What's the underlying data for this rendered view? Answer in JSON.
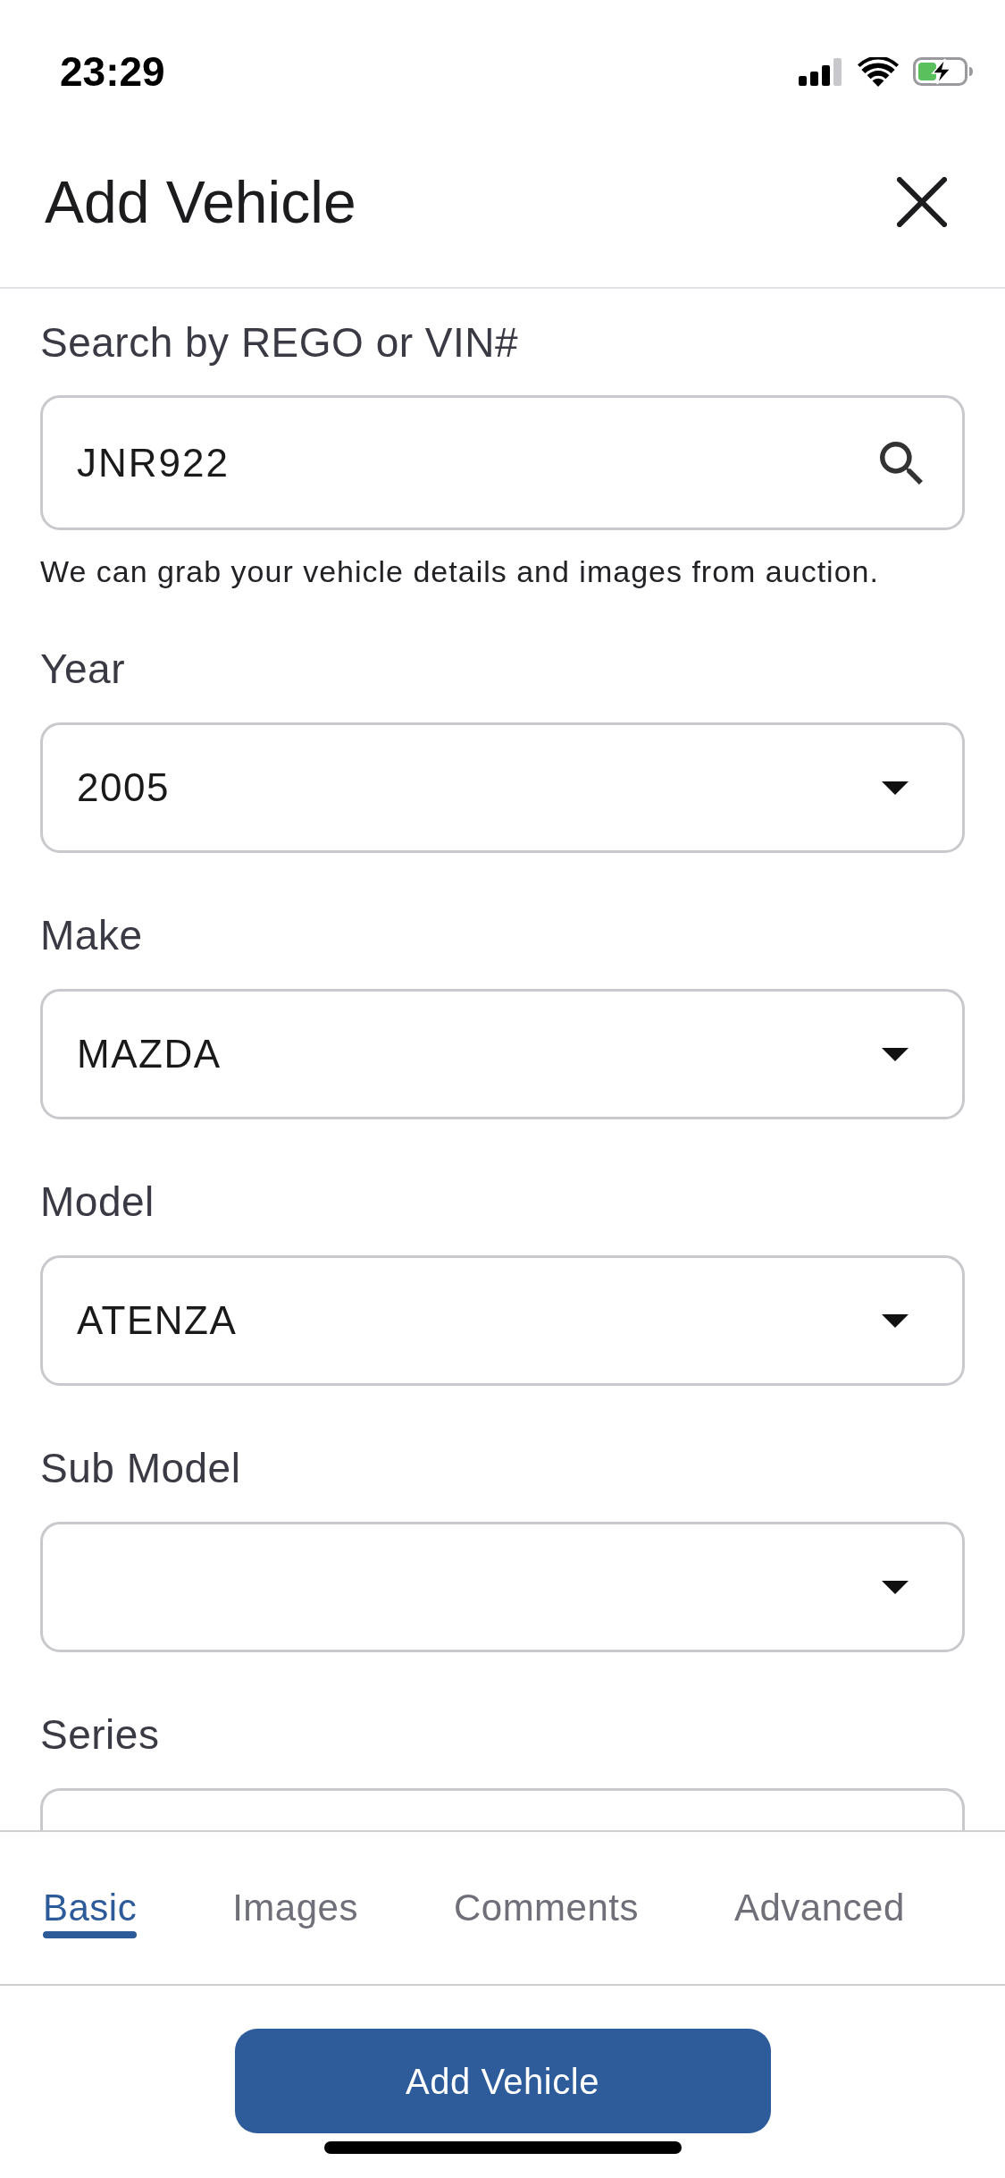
{
  "status_bar": {
    "time": "23:29"
  },
  "header": {
    "title": "Add Vehicle"
  },
  "search": {
    "label": "Search by REGO or VIN#",
    "value": "JNR922",
    "helper": "We can grab your vehicle details and images from auction."
  },
  "fields": [
    {
      "label": "Year",
      "value": "2005"
    },
    {
      "label": "Make",
      "value": "MAZDA"
    },
    {
      "label": "Model",
      "value": "ATENZA"
    },
    {
      "label": "Sub Model"
    },
    {
      "label": "Series"
    }
  ],
  "tabs": [
    {
      "label": "Basic",
      "selected": true
    },
    {
      "label": "Images",
      "selected": false
    },
    {
      "label": "Comments",
      "selected": false
    },
    {
      "label": "Advanced",
      "selected": false
    }
  ],
  "primary_button": {
    "label": "Add Vehicle"
  }
}
